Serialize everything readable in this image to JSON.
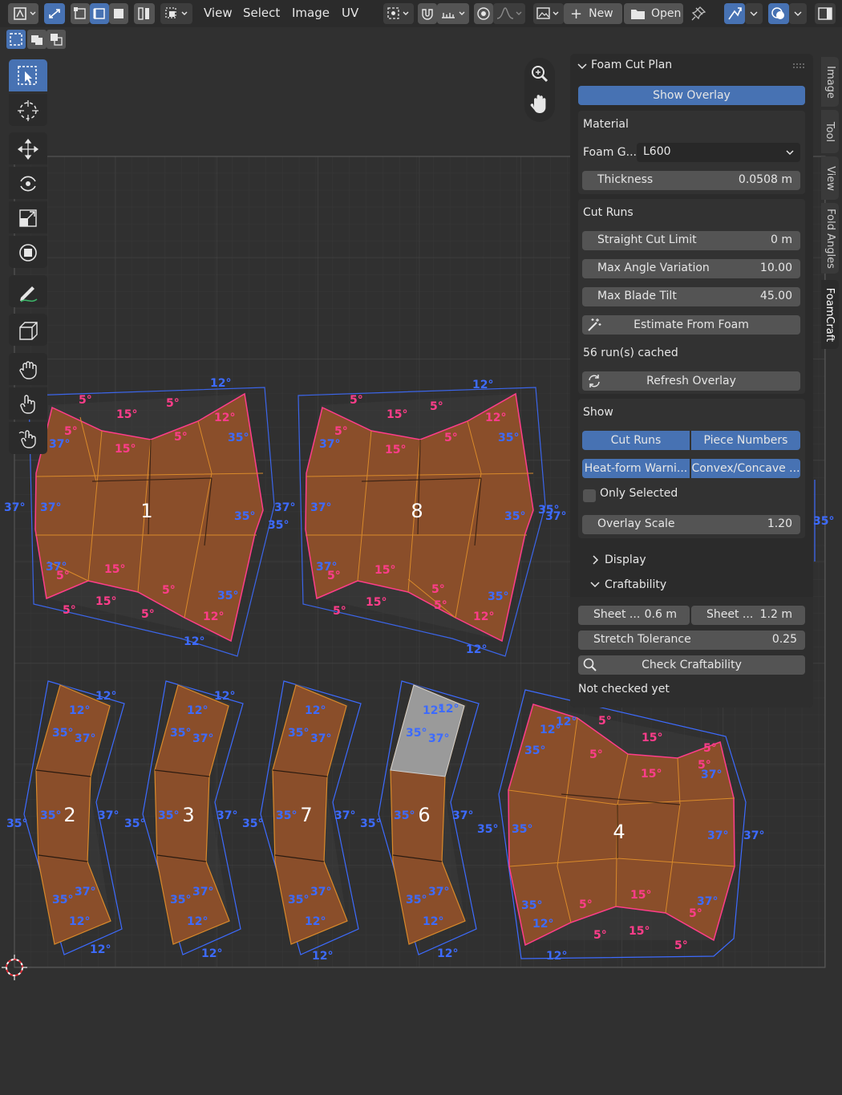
{
  "header": {
    "menus": [
      "View",
      "Select",
      "Image",
      "UV"
    ],
    "new_label": "New",
    "open_label": "Open"
  },
  "viewport": {
    "pieces": [
      {
        "number": "1"
      },
      {
        "number": "8"
      },
      {
        "number": "2"
      },
      {
        "number": "3"
      },
      {
        "number": "7"
      },
      {
        "number": "6"
      },
      {
        "number": "4"
      }
    ],
    "angle_labels": {
      "p5": "5°",
      "p15": "15°",
      "b12": "12°",
      "p12": "12°",
      "b35": "35°",
      "b37": "37°"
    }
  },
  "sidebar_tabs": [
    "Image",
    "Tool",
    "View",
    "Fold Angles",
    "FoamCraft"
  ],
  "panel": {
    "title": "Foam Cut Plan",
    "show_overlay": "Show Overlay",
    "material": {
      "heading": "Material",
      "foam_grade_label": "Foam G...",
      "foam_grade_value": "L600",
      "thickness_label": "Thickness",
      "thickness_value": "0.0508 m"
    },
    "cut_runs": {
      "heading": "Cut Runs",
      "straight_cut_limit_label": "Straight Cut Limit",
      "straight_cut_limit_value": "0 m",
      "max_angle_variation_label": "Max Angle Variation",
      "max_angle_variation_value": "10.00",
      "max_blade_tilt_label": "Max Blade Tilt",
      "max_blade_tilt_value": "45.00",
      "estimate_label": "Estimate From Foam",
      "cached_status": "56 run(s) cached",
      "refresh_label": "Refresh Overlay"
    },
    "show": {
      "heading": "Show",
      "cut_runs": "Cut Runs",
      "piece_numbers": "Piece Numbers",
      "heat_form": "Heat-form Warni...",
      "convex_concave": "Convex/Concave ...",
      "only_selected": "Only Selected",
      "overlay_scale_label": "Overlay Scale",
      "overlay_scale_value": "1.20"
    },
    "display_label": "Display",
    "craftability": {
      "heading": "Craftability",
      "sheet_w_label": "Sheet ...",
      "sheet_w_value": "0.6 m",
      "sheet_h_label": "Sheet ...",
      "sheet_h_value": "1.2 m",
      "stretch_label": "Stretch Tolerance",
      "stretch_value": "0.25",
      "check_label": "Check Craftability",
      "status": "Not checked yet"
    }
  },
  "colors": {
    "header_bg": "#2b2b2b",
    "viewport_bg": "#303030",
    "active_blue": "#4772b3",
    "piece_fill": "#8a4e2a",
    "cut_run_pink": "#ff3d8a",
    "angle_blue": "#3d6bff"
  }
}
